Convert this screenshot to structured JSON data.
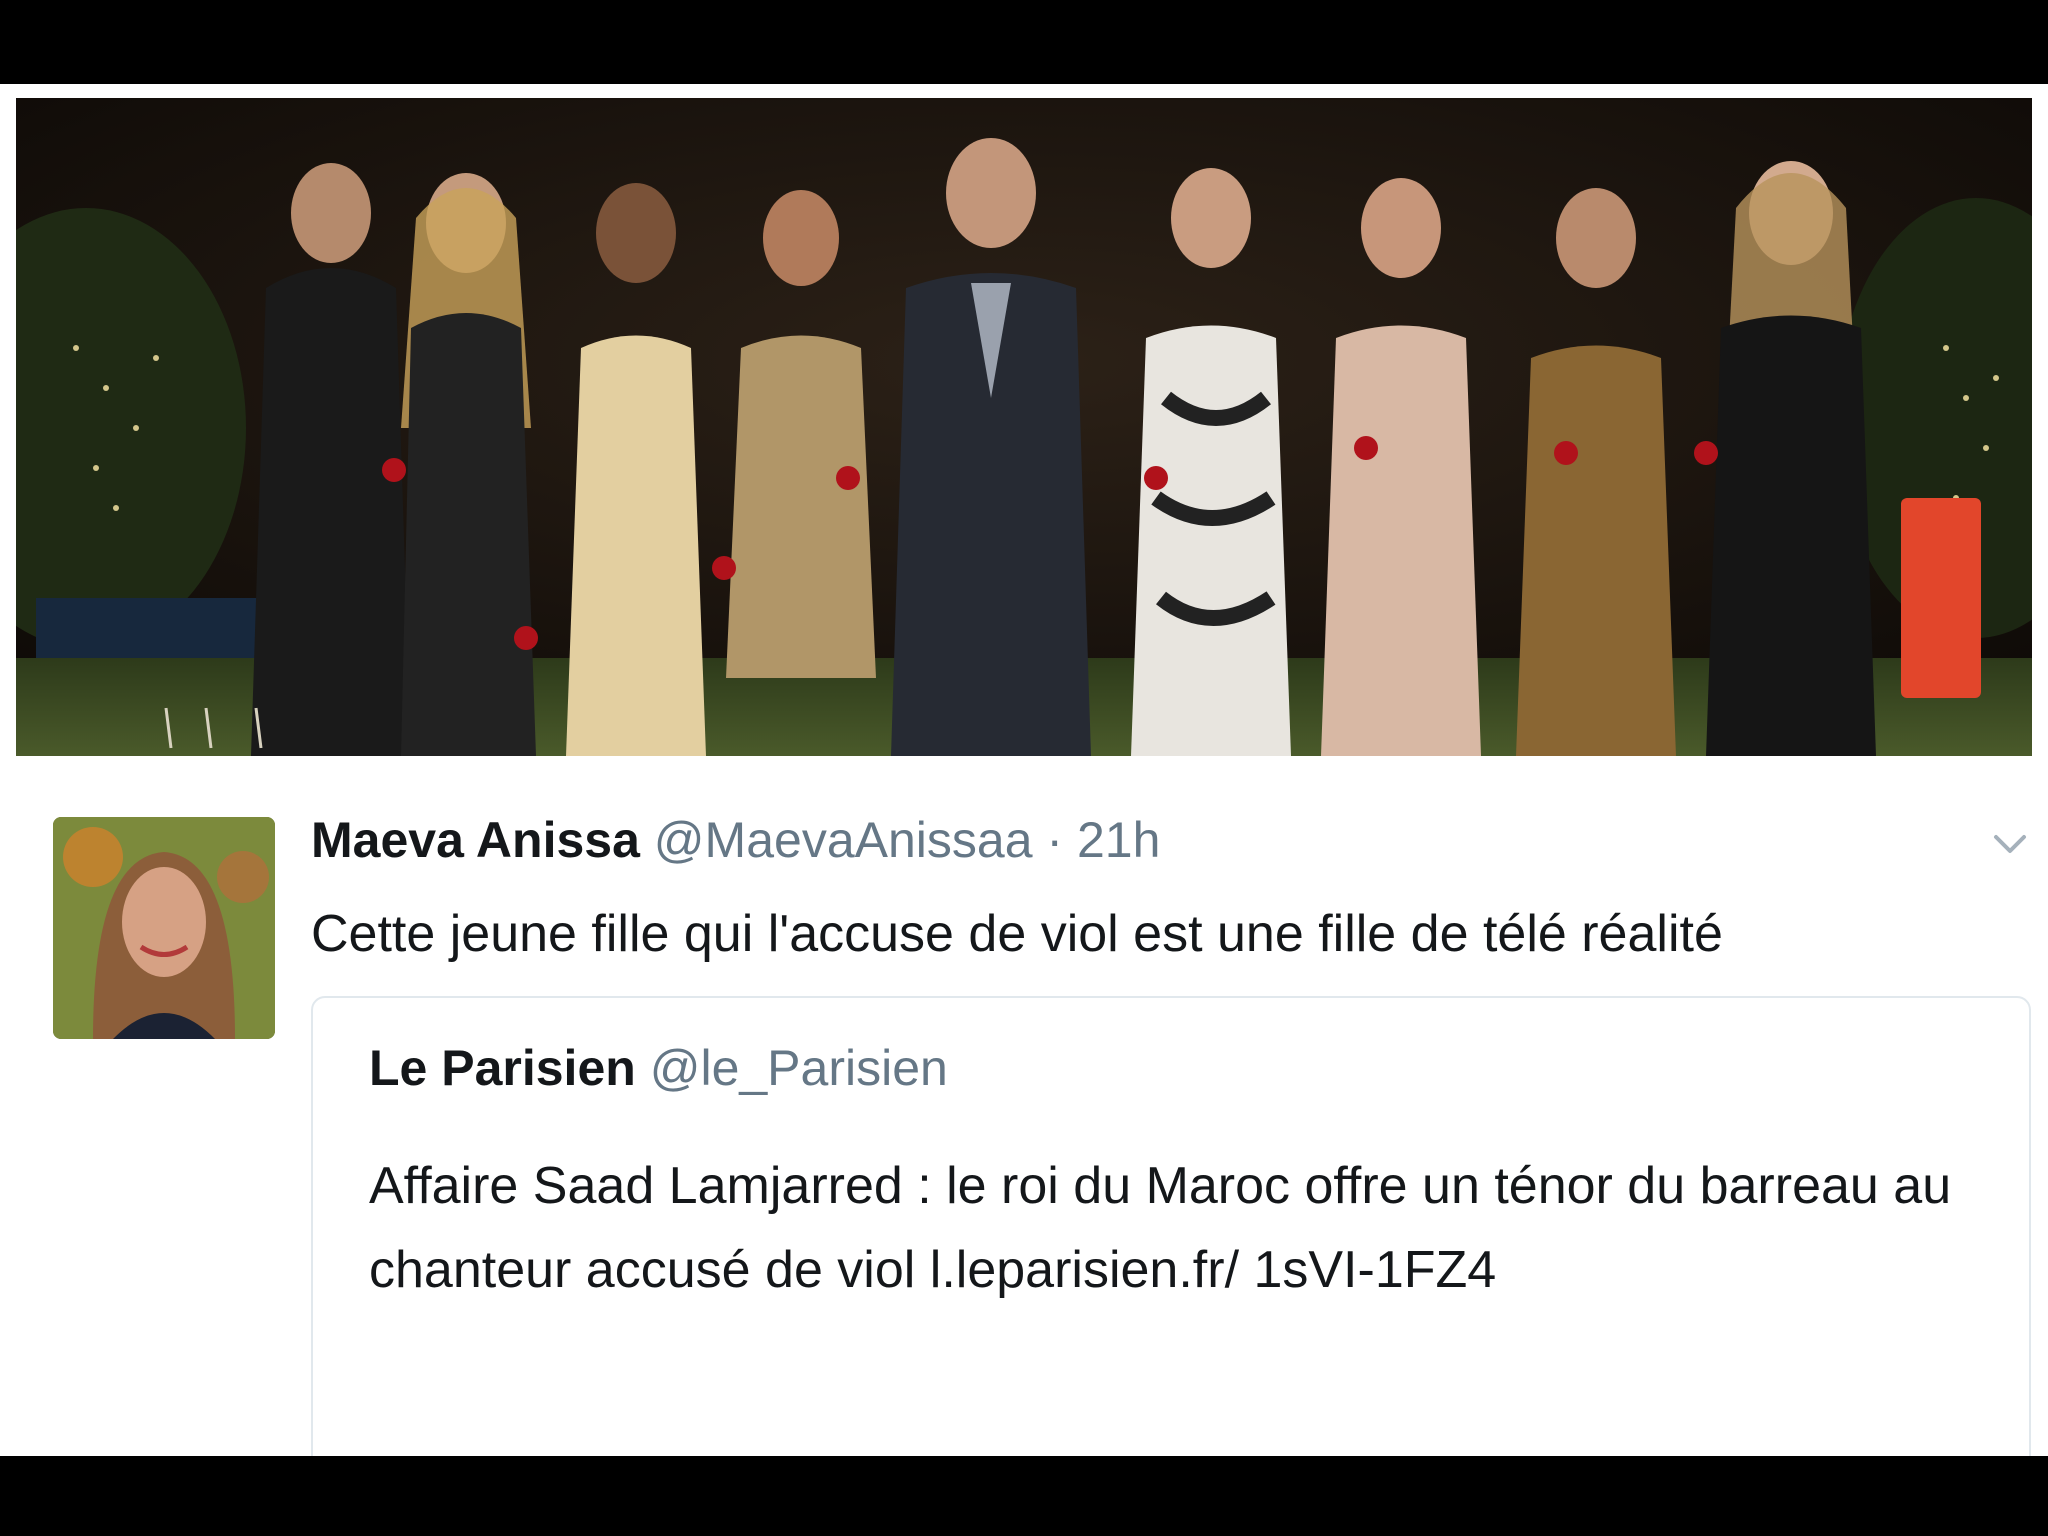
{
  "tweet": {
    "author_name": "Maeva Anissa",
    "author_handle": "@MaevaAnissaa",
    "separator": "·",
    "time": "21h",
    "text": "Cette jeune fille qui l'accuse de viol est une fille de télé réalité",
    "avatar_icon": "profile-photo",
    "menu_icon": "chevron-down-icon"
  },
  "quoted_tweet": {
    "author_name": "Le Parisien",
    "author_handle": "@le_Parisien",
    "text": "Affaire Saad Lamjarred : le roi du Maroc offre un ténor du barreau au chanteur accusé de viol l.leparisien.fr/ 1sVI-1FZ4"
  },
  "colors": {
    "text_primary": "#14171a",
    "text_secondary": "#657786",
    "card_border": "#e1e8ed"
  }
}
